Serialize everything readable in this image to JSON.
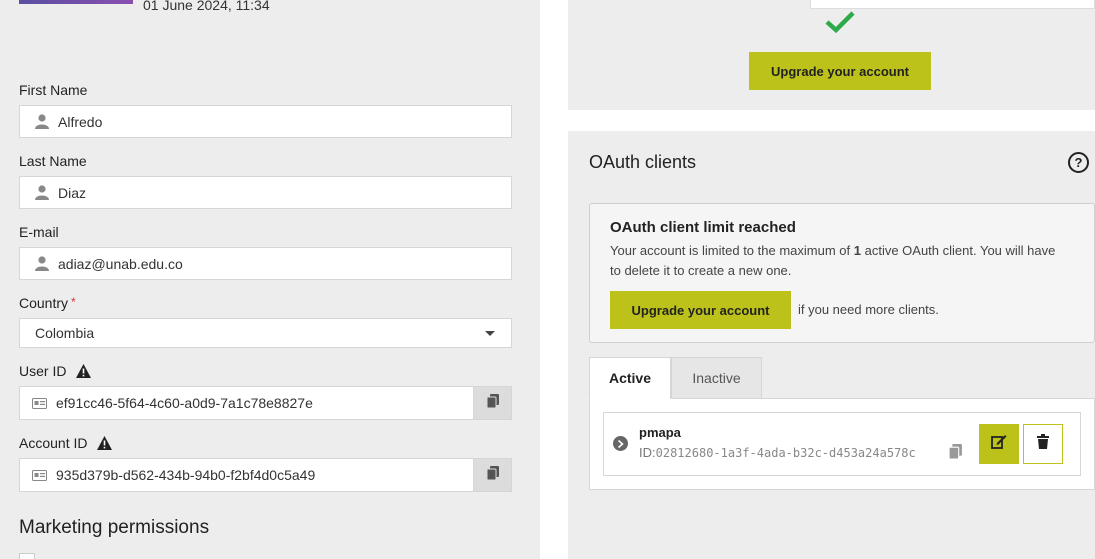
{
  "profile": {
    "date": "01 June 2024, 11:34",
    "first_name": {
      "label": "First Name",
      "value": "Alfredo"
    },
    "last_name": {
      "label": "Last Name",
      "value": "Diaz"
    },
    "email": {
      "label": "E-mail",
      "value": "adiaz@unab.edu.co"
    },
    "country": {
      "label": "Country",
      "required_mark": "*",
      "value": "Colombia"
    },
    "user_id": {
      "label": "User ID",
      "value": "ef91cc46-5f64-4c60-a0d9-7a1c78e8827e"
    },
    "account_id": {
      "label": "Account ID",
      "value": "935d379b-d562-434b-94b0-f2bf4d0c5a49"
    },
    "marketing_title": "Marketing permissions"
  },
  "top_card": {
    "upgrade_label": "Upgrade your account"
  },
  "oauth": {
    "title": "OAuth clients",
    "help": "?",
    "limit_title": "OAuth client limit reached",
    "limit_text_before": "Your account is limited to the maximum of ",
    "limit_count": "1",
    "limit_text_after": " active OAuth client. You will have to delete it to create a new one.",
    "upgrade_label": "Upgrade your account",
    "upgrade_suffix": "if you need more clients.",
    "tabs": [
      {
        "label": "Active"
      },
      {
        "label": "Inactive"
      }
    ],
    "client": {
      "name": "pmapa",
      "id_prefix": "ID:",
      "id": "02812680-1a3f-4ada-b32c-d453a24a578c"
    }
  },
  "colors": {
    "accent": "#bcc21a",
    "panel_bg": "#ededed",
    "check_green": "#2eaa4a"
  }
}
